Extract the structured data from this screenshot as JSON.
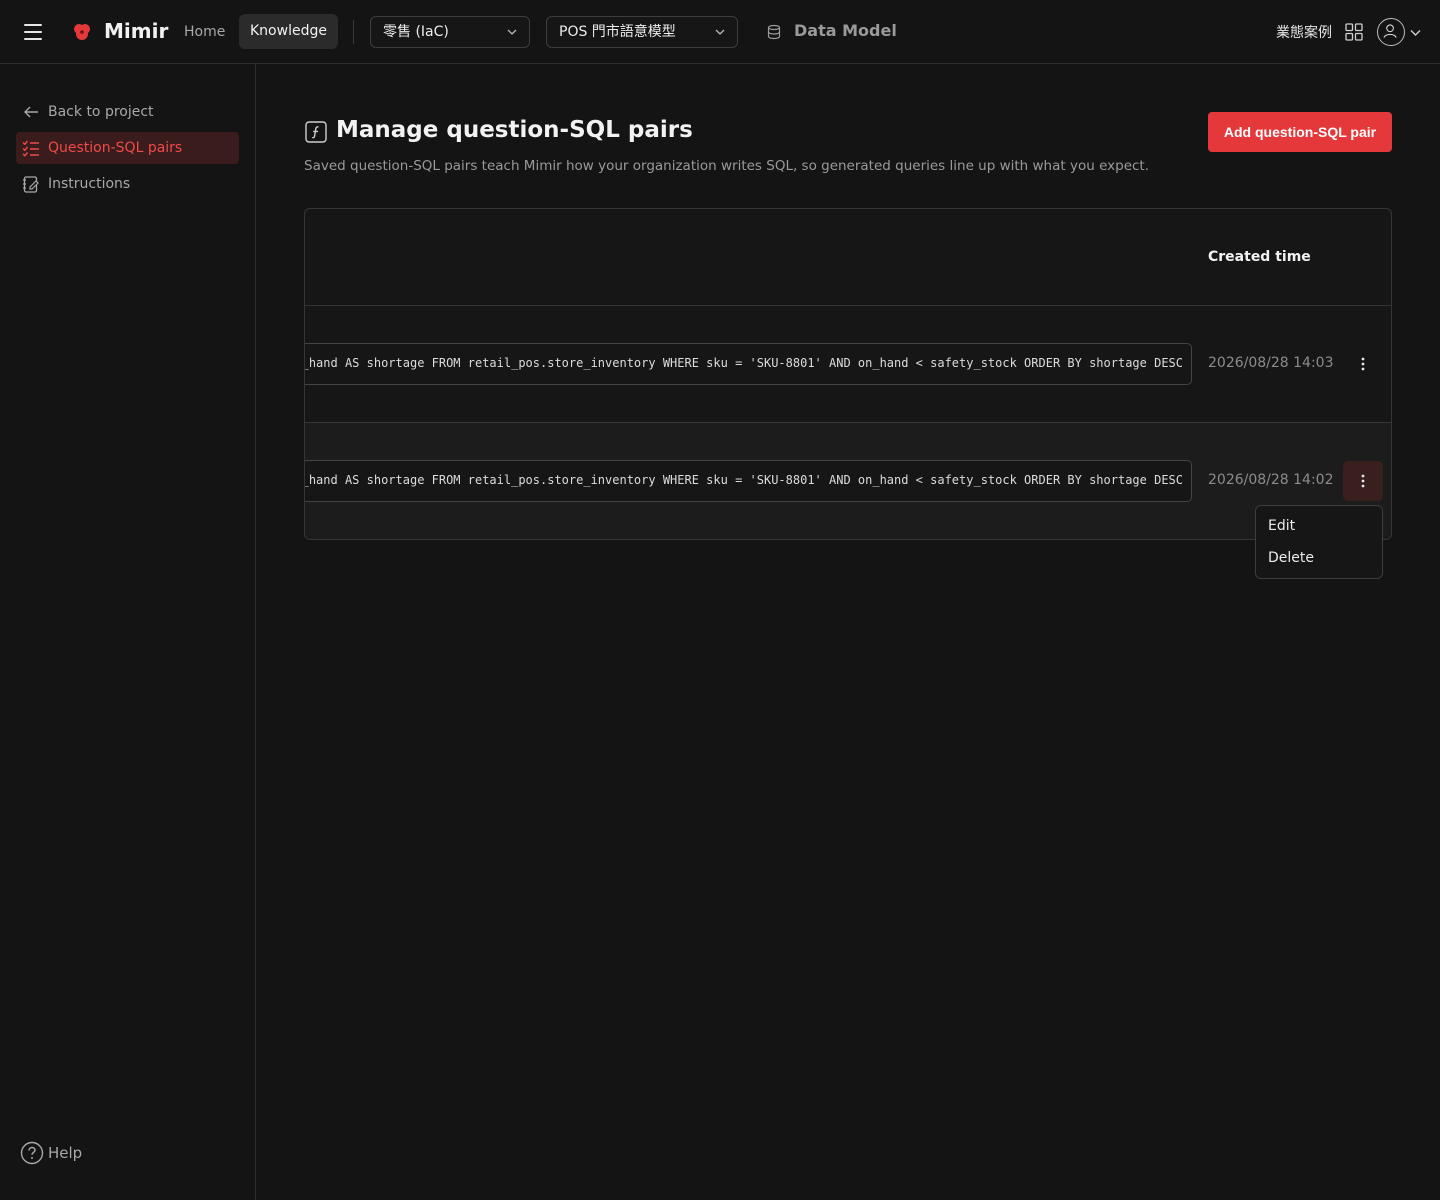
{
  "app": {
    "name": "Mimir"
  },
  "nav": {
    "home": "Home",
    "knowledge": "Knowledge"
  },
  "selectors": {
    "project": "零售 (IaC)",
    "model": "POS 門市語意模型"
  },
  "data_model_label": "Data Model",
  "header_right": {
    "case_label": "業態案例"
  },
  "sidebar": {
    "back": "Back to project",
    "items": [
      {
        "label": "Question-SQL pairs",
        "active": true
      },
      {
        "label": "Instructions",
        "active": false
      }
    ],
    "help": "Help"
  },
  "page": {
    "title": "Manage question-SQL pairs",
    "description": "Saved question-SQL pairs teach Mimir how your organization writes SQL, so generated queries line up with what you expect.",
    "add_button": "Add question-SQL pair"
  },
  "table": {
    "columns": [
      "Created time"
    ],
    "rows": [
      {
        "sql": "_hand AS shortage FROM retail_pos.store_inventory WHERE sku = 'SKU-8801' AND on_hand < safety_stock ORDER BY shortage DESC",
        "created": "2026/08/28 14:03"
      },
      {
        "sql": "_hand AS shortage FROM retail_pos.store_inventory WHERE sku = 'SKU-8801' AND on_hand < safety_stock ORDER BY shortage DESC",
        "created": "2026/08/28 14:02"
      }
    ]
  },
  "row_menu": {
    "edit": "Edit",
    "delete": "Delete"
  },
  "colors": {
    "accent": "#e5383b",
    "active_bg": "#3a1c1c",
    "active_text": "#f04a4a",
    "background": "#141414"
  }
}
